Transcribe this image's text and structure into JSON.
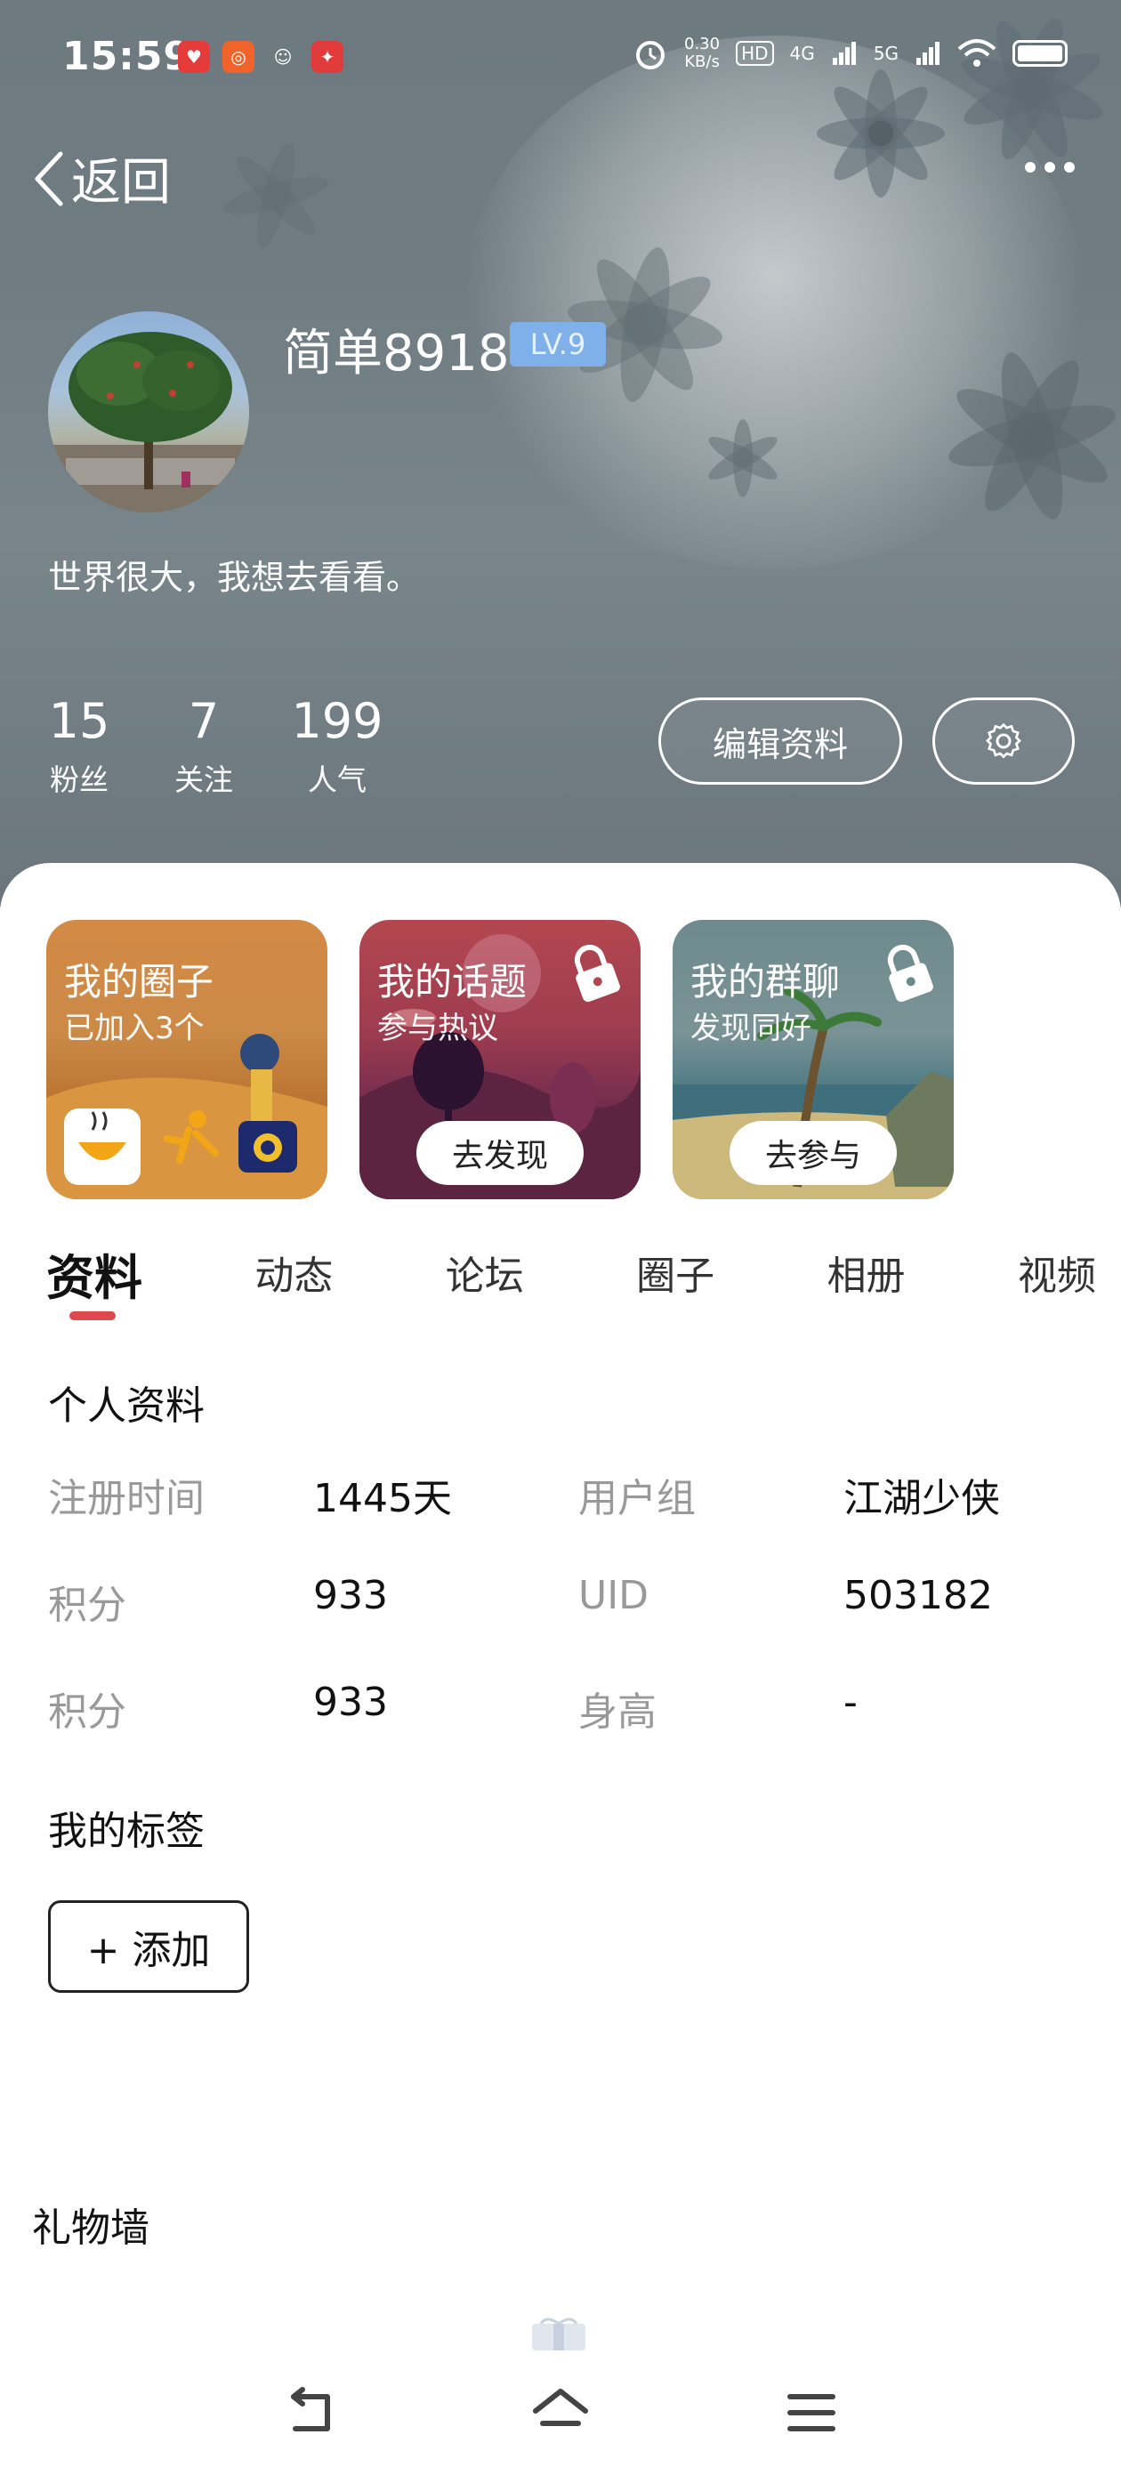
{
  "status_bar": {
    "time": "15:59",
    "net_speed_value": "0.30",
    "net_speed_unit": "KB/s",
    "hd_label": "HD",
    "net1": "4G",
    "net2": "5G"
  },
  "nav": {
    "back_label": "返回"
  },
  "profile": {
    "username": "简单8918",
    "level": "LV.9",
    "bio": "世界很大，我想去看看。",
    "stats": [
      {
        "value": "15",
        "label": "粉丝"
      },
      {
        "value": "7",
        "label": "关注"
      },
      {
        "value": "199",
        "label": "人气"
      }
    ],
    "edit_label": "编辑资料"
  },
  "cards": [
    {
      "title": "我的圈子",
      "subtitle": "已加入3个",
      "button": ""
    },
    {
      "title": "我的话题",
      "subtitle": "参与热议",
      "button": "去发现"
    },
    {
      "title": "我的群聊",
      "subtitle": "发现同好",
      "button": "去参与"
    }
  ],
  "tabs": [
    "资料",
    "动态",
    "论坛",
    "圈子",
    "相册",
    "视频"
  ],
  "active_tab_index": 0,
  "personal_info": {
    "section_title": "个人资料",
    "rows": [
      {
        "k1": "注册时间",
        "v1": "1445天",
        "k2": "用户组",
        "v2": "江湖少侠"
      },
      {
        "k1": "积分",
        "v1": "933",
        "k2": "UID",
        "v2": "503182"
      },
      {
        "k1": "积分",
        "v1": "933",
        "k2": "身高",
        "v2": "-"
      }
    ]
  },
  "tags": {
    "section_title": "我的标签",
    "add_label": "+ 添加"
  },
  "gift_wall": {
    "title": "礼物墙"
  },
  "colors": {
    "accent": "#e0484f",
    "level_badge": "#7fb0ea"
  },
  "icons": {
    "back": "chevron-left-icon",
    "more": "more-dots-icon",
    "settings": "gear-icon",
    "lock": "lock-icon",
    "nav_back": "return-icon",
    "nav_home": "home-icon",
    "nav_menu": "menu-icon"
  }
}
